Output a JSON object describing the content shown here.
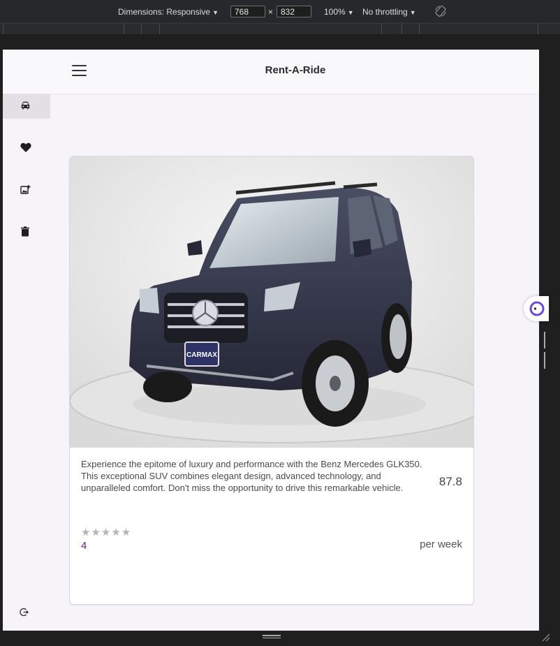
{
  "devtools": {
    "dimensions_label": "Dimensions: Responsive",
    "width": "768",
    "times": "×",
    "height": "832",
    "zoom": "100%",
    "throttling": "No throttling",
    "icons": {
      "rotate": "rotate-icon",
      "caret": "caret-down-icon"
    }
  },
  "app": {
    "title": "Rent-A-Ride",
    "icons": {
      "menu": "hamburger-menu-icon"
    }
  },
  "sidebar": {
    "items": [
      {
        "icon": "car-icon",
        "active": true
      },
      {
        "icon": "heart-icon",
        "active": false
      },
      {
        "icon": "add-photo-icon",
        "active": false
      },
      {
        "icon": "trash-icon",
        "active": false
      }
    ],
    "logout_icon": "logout-icon"
  },
  "listing": {
    "image_alt": "black-suv-image",
    "description": "Experience the epitome of luxury and performance with the Benz Mercedes GLK350. This exceptional SUV combines elegant design, advanced technology, and unparalleled comfort. Don't miss the opportunity to drive this remarkable vehicle.",
    "price": "87.8",
    "stars": "★★★★★",
    "rating": "4",
    "rating_max": 5,
    "price_unit": "per week",
    "plate_text": "CARMAX"
  },
  "colors": {
    "accent": "#5a2a86",
    "active_sidebar_bg": "#e2dfe5",
    "page_bg": "#f6f4f9"
  }
}
